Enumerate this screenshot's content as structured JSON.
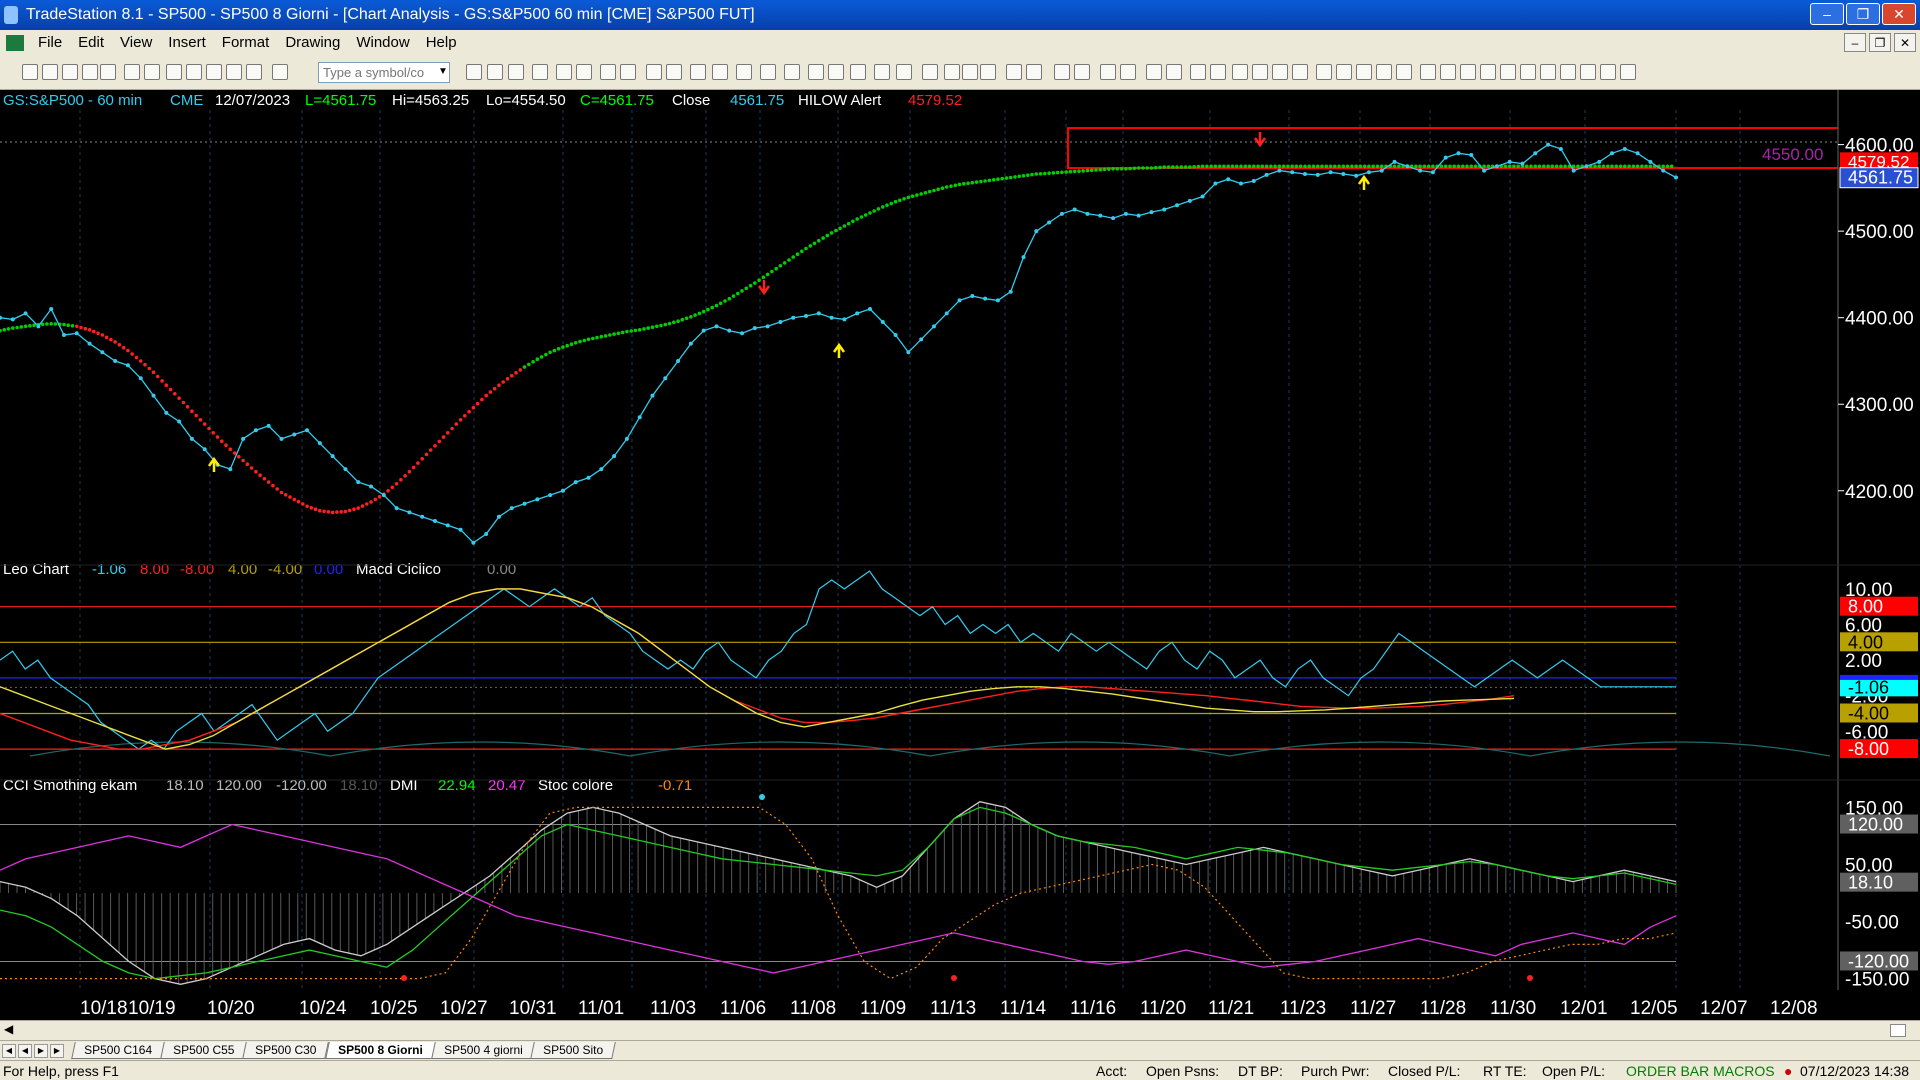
{
  "window": {
    "title": "TradeStation 8.1 - SP500 - SP500 8 Giorni - [Chart Analysis - GS:S&P500  60 min  [CME] S&P500 FUT]"
  },
  "menu": [
    "File",
    "Edit",
    "View",
    "Insert",
    "Format",
    "Drawing",
    "Window",
    "Help"
  ],
  "toolbar": {
    "symbol_placeholder": "Type a symbol/co"
  },
  "price_header": {
    "symbol": "GS:S&P500 - 60 min",
    "exchange": "CME",
    "date": "12/07/2023",
    "low_label": "L=4561.75",
    "high_label": "Hi=4563.25",
    "lo_label": "Lo=4554.50",
    "close_label": "C=4561.75",
    "close_word": "Close",
    "close_value": "4561.75",
    "alert_name": "HILOW Alert",
    "alert_value": "4579.52"
  },
  "leo_header": {
    "name": "Leo Chart",
    "values": [
      "-1.06",
      "8.00",
      "-8.00",
      "4.00",
      "-4.00",
      "0.00"
    ],
    "macd_name": "Macd Ciclico",
    "macd_value": "0.00"
  },
  "cci_header": {
    "name": "CCI Smothing ekam",
    "values": [
      "18.10",
      "120.00",
      "-120.00",
      "18.10"
    ],
    "dmi_name": "DMI",
    "dmi_values": [
      "22.94",
      "20.47"
    ],
    "stoc_name": "Stoc colore",
    "stoc_value": "-0.71"
  },
  "price_axis": {
    "ticks": [
      "4600.00",
      "4500.00",
      "4400.00",
      "4300.00",
      "4200.00"
    ],
    "label_4550": "4550.00",
    "label_alert": "4579.52",
    "label_last": "4561.75"
  },
  "leo_axis": {
    "ticks": [
      "10.00",
      "6.00",
      "2.00",
      "-2.00",
      "-6.00"
    ],
    "badges": [
      "8.00",
      "4.00",
      "-1.06",
      "-4.00",
      "-8.00"
    ]
  },
  "cci_axis": {
    "ticks": [
      "150.00",
      "50.00",
      "-50.00",
      "-150.00"
    ],
    "badges": [
      "120.00",
      "18.10",
      "-120.00"
    ]
  },
  "date_axis": [
    "10/18",
    "10/19",
    "10/20",
    "10/24",
    "10/25",
    "10/27",
    "10/31",
    "11/01",
    "11/03",
    "11/06",
    "11/08",
    "11/09",
    "11/13",
    "11/14",
    "11/16",
    "11/20",
    "11/21",
    "11/23",
    "11/27",
    "11/28",
    "11/30",
    "12/01",
    "12/05",
    "12/07",
    "12/08"
  ],
  "colors": {
    "up_ma": "#00d000",
    "down_ma": "#ff2020",
    "price": "#33ccee",
    "box": "#ff0000",
    "arrow_up": "#ffee00",
    "arrow_down": "#ff2020"
  },
  "chart_data": [
    {
      "type": "line",
      "title": "GS:S&P500 - 60 min",
      "ylim": [
        4120,
        4640
      ],
      "x_label_count": 25,
      "series": [
        {
          "name": "",
          "values": [
            4400,
            4398,
            4405,
            4390,
            4410,
            4380,
            4382,
            4370,
            4360,
            4350,
            4345,
            4330,
            4310,
            4290,
            4280,
            4260,
            4248,
            4230,
            4225,
            4260,
            4270,
            4275,
            4260,
            4265,
            4270,
            4255,
            4240,
            4225,
            4210,
            4205,
            4195,
            4180,
            4175,
            4170,
            4165,
            4160,
            4155,
            4140,
            4150,
            4170,
            4180,
            4185,
            4190,
            4195,
            4200,
            4210,
            4215,
            4225,
            4240,
            4260,
            4285,
            4310,
            4330,
            4350,
            4370,
            4385,
            4390,
            4385,
            4382,
            4388,
            4390,
            4395,
            4400,
            4402,
            4405,
            4400,
            4398,
            4405,
            4410,
            4395,
            4380,
            4360,
            4375,
            4390,
            4405,
            4420,
            4425,
            4422,
            4420,
            4430,
            4470,
            4500,
            4510,
            4520,
            4525,
            4520,
            4518,
            4515,
            4520,
            4518,
            4522,
            4525,
            4530,
            4535,
            4540,
            4555,
            4560,
            4555,
            4558,
            4565,
            4570,
            4568,
            4566,
            4565,
            4568,
            4566,
            4564,
            4568,
            4570,
            4580,
            4575,
            4570,
            4568,
            4585,
            4590,
            4588,
            4570,
            4575,
            4580,
            4578,
            4590,
            4600,
            4595,
            4570,
            4575,
            4580,
            4590,
            4595,
            4590,
            4580,
            4570,
            4562
          ]
        },
        {
          "name": "",
          "values": [
            4385,
            4388,
            4390,
            4392,
            4393,
            4392,
            4390,
            4386,
            4380,
            4372,
            4362,
            4350,
            4337,
            4322,
            4307,
            4292,
            4277,
            4262,
            4248,
            4235,
            4222,
            4210,
            4198,
            4190,
            4182,
            4177,
            4175,
            4176,
            4180,
            4187,
            4196,
            4208,
            4222,
            4237,
            4252,
            4267,
            4282,
            4296,
            4310,
            4322,
            4333,
            4343,
            4352,
            4360,
            4366,
            4371,
            4375,
            4378,
            4381,
            4384,
            4386,
            4389,
            4392,
            4396,
            4401,
            4407,
            4414,
            4422,
            4431,
            4440,
            4450,
            4460,
            4470,
            4480,
            4489,
            4498,
            4506,
            4514,
            4521,
            4528,
            4534,
            4539,
            4543,
            4547,
            4551,
            4554,
            4556,
            4558,
            4560,
            4562,
            4564,
            4566,
            4567,
            4568,
            4569,
            4570,
            4571,
            4572,
            4572,
            4573,
            4573,
            4574,
            4574,
            4574,
            4575,
            4575,
            4575,
            4575,
            4575,
            4575,
            4575,
            4575,
            4575,
            4575,
            4575,
            4575,
            4575,
            4575,
            4575,
            4575,
            4575,
            4575,
            4575,
            4575,
            4575,
            4575,
            4575,
            4575,
            4575,
            4575,
            4575,
            4575,
            4575,
            4575,
            4575,
            4575,
            4575,
            4575,
            4575,
            4575,
            4575,
            4575
          ]
        }
      ]
    },
    {
      "type": "line",
      "title": "Leo Chart",
      "ylim": [
        -9,
        11
      ],
      "series": [
        {
          "name": "",
          "values": [
            2,
            3,
            1,
            2,
            0,
            -1,
            -2,
            -3,
            -5,
            -6,
            -7,
            -8,
            -7,
            -8,
            -6,
            -5,
            -4,
            -6,
            -5,
            -4,
            -3,
            -5,
            -7,
            -6,
            -5,
            -4,
            -6,
            -5,
            -4,
            -2,
            0,
            1,
            2,
            3,
            4,
            5,
            6,
            7,
            8,
            9,
            10,
            9,
            8,
            9,
            10,
            9,
            8,
            9,
            7,
            6,
            5,
            3,
            2,
            1,
            2,
            1,
            3,
            4,
            2,
            1,
            0,
            2,
            3,
            5,
            6,
            10,
            11,
            10,
            11,
            12,
            10,
            9,
            8,
            7,
            8,
            6,
            7,
            5,
            6,
            5,
            6,
            4,
            5,
            4,
            3,
            5,
            4,
            3,
            4,
            3,
            2,
            1,
            3,
            4,
            2,
            1,
            3,
            2,
            0,
            1,
            2,
            0,
            -1,
            1,
            2,
            0,
            -1,
            -2,
            0,
            1,
            3,
            5,
            4,
            3,
            2,
            1,
            0,
            -1,
            0,
            1,
            2,
            1,
            0,
            1,
            2,
            1,
            0,
            -1,
            -1,
            -1,
            -1,
            -1,
            -1,
            -1
          ]
        },
        {
          "name": "",
          "values": [
            -4,
            -5,
            -6,
            -7,
            -7.5,
            -8,
            -8,
            -7.5,
            -7,
            -6,
            -5,
            -3.5,
            -2,
            -0.5,
            1,
            2.5,
            4,
            5.5,
            7,
            8.5,
            9.5,
            10,
            10,
            9.5,
            9,
            8,
            6.5,
            5,
            3,
            1,
            -1,
            -2.5,
            -3.5,
            -4.5,
            -5,
            -5,
            -4.8,
            -4.5,
            -4,
            -3.5,
            -3,
            -2.5,
            -2,
            -1.5,
            -1.2,
            -1,
            -1,
            -1.2,
            -1.4,
            -1.6,
            -1.8,
            -2,
            -2.3,
            -2.6,
            -2.9,
            -3.2,
            -3.3,
            -3.4,
            -3.4,
            -3.3,
            -3.2,
            -3,
            -2.7,
            -2.4,
            -2
          ]
        },
        {
          "name": "",
          "values": [
            -1,
            -2,
            -3,
            -4,
            -5,
            -6,
            -7,
            -8,
            -7.5,
            -6.5,
            -5,
            -3.5,
            -2,
            -0.5,
            1,
            2.5,
            4,
            5.5,
            7,
            8.5,
            9.5,
            10,
            10,
            9.5,
            9,
            8,
            6.5,
            5,
            3,
            1,
            -1,
            -2.5,
            -4,
            -5,
            -5.5,
            -5,
            -4.5,
            -4,
            -3.2,
            -2.5,
            -2,
            -1.5,
            -1.2,
            -1,
            -1,
            -1.2,
            -1.5,
            -1.8,
            -2.2,
            -2.6,
            -3,
            -3.4,
            -3.6,
            -3.8,
            -3.8,
            -3.7,
            -3.6,
            -3.4,
            -3.2,
            -3,
            -2.8,
            -2.6,
            -2.5,
            -2.4,
            -2.3
          ]
        }
      ]
    },
    {
      "type": "line",
      "title": "CCI Smothing ekam",
      "ylim": [
        -170,
        170
      ],
      "series": [
        {
          "name": "",
          "values": [
            20,
            10,
            -10,
            -40,
            -80,
            -120,
            -150,
            -160,
            -150,
            -130,
            -110,
            -90,
            -80,
            -100,
            -110,
            -90,
            -60,
            -30,
            0,
            30,
            70,
            110,
            140,
            150,
            140,
            120,
            100,
            90,
            80,
            70,
            60,
            50,
            40,
            30,
            10,
            30,
            80,
            130,
            160,
            150,
            120,
            100,
            90,
            80,
            70,
            60,
            50,
            60,
            70,
            80,
            70,
            60,
            50,
            40,
            30,
            40,
            50,
            60,
            50,
            40,
            30,
            20,
            30,
            40,
            30,
            20
          ]
        },
        {
          "name": "",
          "values": [
            -30,
            -40,
            -60,
            -90,
            -120,
            -140,
            -150,
            -145,
            -140,
            -130,
            -120,
            -110,
            -100,
            -110,
            -120,
            -130,
            -100,
            -60,
            -20,
            20,
            60,
            100,
            120,
            110,
            100,
            90,
            80,
            70,
            60,
            55,
            50,
            45,
            40,
            35,
            30,
            40,
            80,
            130,
            150,
            140,
            120,
            100,
            90,
            85,
            80,
            70,
            60,
            70,
            80,
            75,
            70,
            60,
            50,
            45,
            40,
            45,
            50,
            55,
            50,
            40,
            30,
            25,
            30,
            35,
            25,
            15
          ]
        },
        {
          "name": "",
          "values": [
            40,
            60,
            70,
            80,
            90,
            100,
            90,
            80,
            100,
            120,
            110,
            100,
            90,
            80,
            70,
            60,
            40,
            20,
            0,
            -20,
            -40,
            -50,
            -60,
            -70,
            -80,
            -90,
            -100,
            -110,
            -120,
            -130,
            -140,
            -130,
            -120,
            -110,
            -100,
            -90,
            -80,
            -70,
            -80,
            -90,
            -100,
            -110,
            -120,
            -125,
            -120,
            -110,
            -100,
            -110,
            -120,
            -130,
            -125,
            -120,
            -110,
            -100,
            -90,
            -80,
            -90,
            -100,
            -110,
            -90,
            -80,
            -70,
            -80,
            -90,
            -60,
            -40
          ]
        }
      ]
    }
  ]
}
